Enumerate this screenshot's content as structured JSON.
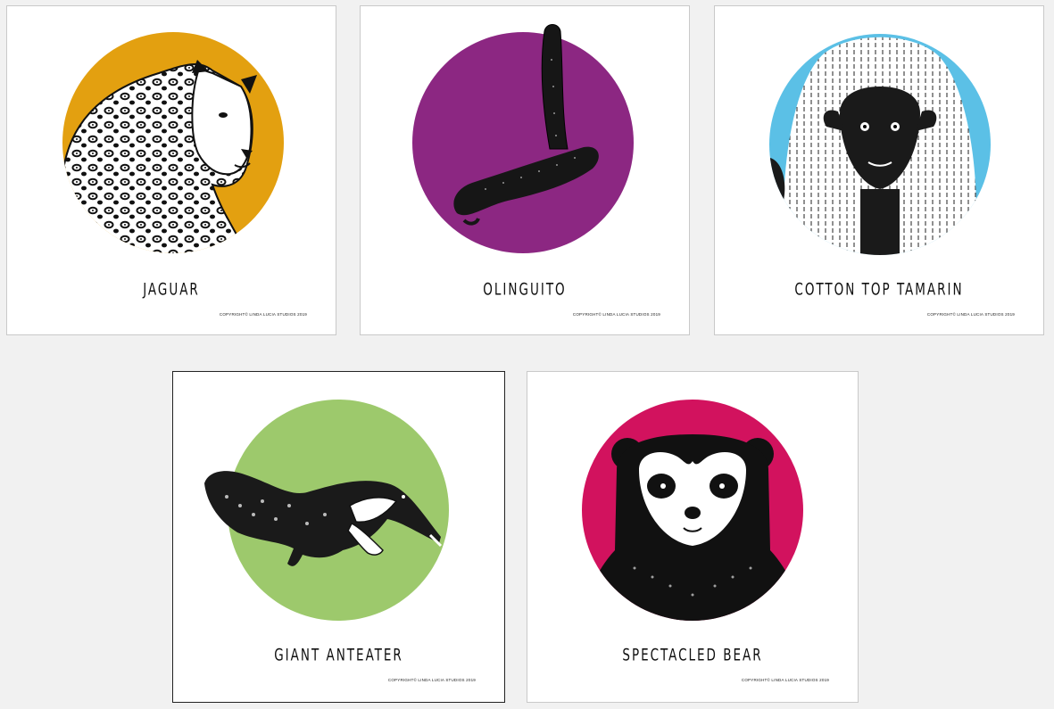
{
  "cards": [
    {
      "title": "JAGUAR",
      "animal": "jaguar-illustration",
      "bg": "#e3a010",
      "copyright": "COPYRIGHT© LINDA LUCIA STUDIOS 2019"
    },
    {
      "title": "OLINGUITO",
      "animal": "olinguito-illustration",
      "bg": "#8c2782",
      "copyright": "COPYRIGHT© LINDA LUCIA STUDIOS 2019"
    },
    {
      "title": "COTTON TOP TAMARIN",
      "animal": "tamarin-illustration",
      "bg": "#5bc0e6",
      "copyright": "COPYRIGHT© LINDA LUCIA STUDIOS 2019"
    },
    {
      "title": "GIANT ANTEATER",
      "animal": "anteater-illustration",
      "bg": "#9dc96c",
      "copyright": "COPYRIGHT© LINDA LUCIA STUDIOS 2019"
    },
    {
      "title": "SPECTACLED BEAR",
      "animal": "bear-illustration",
      "bg": "#d2125e",
      "copyright": "COPYRIGHT© LINDA LUCIA STUDIOS 2019"
    }
  ]
}
